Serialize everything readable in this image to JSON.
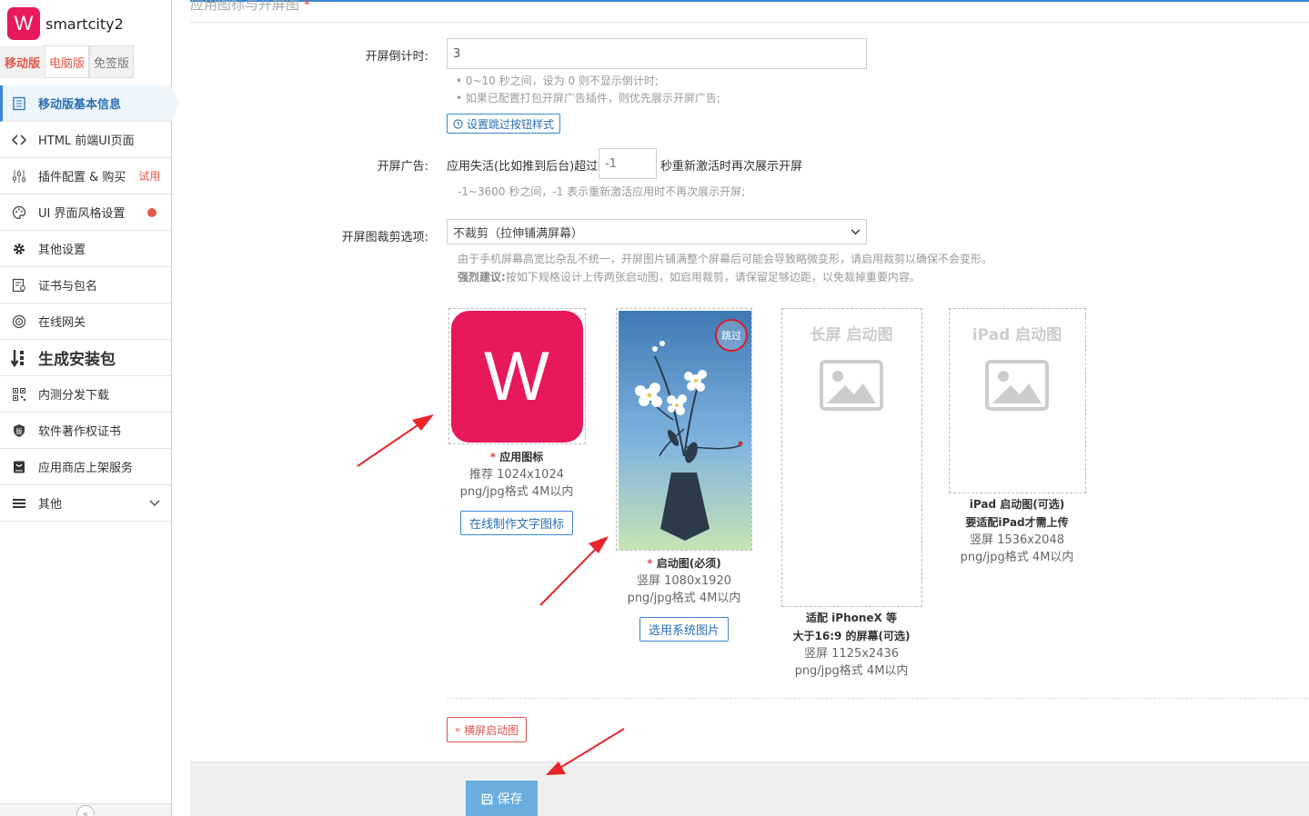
{
  "app": {
    "logo_letter": "W",
    "name": "smartcity2"
  },
  "modes": [
    "移动版",
    "电脑版",
    "免签版"
  ],
  "nav": [
    {
      "label": "移动版基本信息",
      "icon": "document-icon"
    },
    {
      "label": "HTML 前端UI页面",
      "icon": "code-icon"
    },
    {
      "label": "插件配置 & 购买",
      "icon": "sliders-icon",
      "badge": "试用"
    },
    {
      "label": "UI 界面风格设置",
      "icon": "palette-icon"
    },
    {
      "label": "其他设置",
      "icon": "gear-icon"
    },
    {
      "label": "证书与包名",
      "icon": "certificate-icon"
    },
    {
      "label": "在线网关",
      "icon": "gateway-icon"
    },
    {
      "label": "生成安装包",
      "icon": "build-icon"
    },
    {
      "label": "内测分发下载",
      "icon": "qrcode-icon"
    },
    {
      "label": "软件著作权证书",
      "icon": "copyright-icon"
    },
    {
      "label": "应用商店上架服务",
      "icon": "store-icon"
    },
    {
      "label": "其他",
      "icon": "menu-icon"
    }
  ],
  "section": {
    "title": "应用图标与开屏图",
    "star": "*"
  },
  "countdown": {
    "label": "开屏倒计时:",
    "value": "3",
    "hint1": "• 0~10 秒之间，设为 0 则不显示倒计时;",
    "hint2": "• 如果已配置打包开屏广告插件，则优先展示开屏广告;",
    "skip_style_btn": "设置跳过按钮样式"
  },
  "ad": {
    "label": "开屏广告:",
    "prefix": "应用失活(比如推到后台)超过",
    "value": "-1",
    "suffix": "秒重新激活时再次展示开屏",
    "hint": "-1~3600 秒之间，-1 表示重新激活应用时不再次展示开屏;"
  },
  "crop": {
    "label": "开屏图裁剪选项:",
    "selected": "不裁剪（拉伸铺满屏幕）",
    "hint1": "由于手机屏幕高宽比杂乱不统一，开屏图片铺满整个屏幕后可能会导致略微变形，请启用裁剪以确保不会变形。",
    "hint2_bold": "强烈建议:",
    "hint2": "按如下规格设计上传两张启动图，如启用裁剪，请保留足够边距，以免裁掉重要内容。"
  },
  "cards": {
    "icon": {
      "letter": "W",
      "title": "应用图标",
      "size": "推荐 1024x1024",
      "format": "png/jpg格式 4M以内",
      "button": "在线制作文字图标"
    },
    "splash": {
      "skip": "跳过",
      "title": "启动图(必须)",
      "size": "竖屏 1080x1920",
      "format": "png/jpg格式 4M以内",
      "button": "选用系统图片"
    },
    "long": {
      "placeholder": "长屏 启动图",
      "title1": "适配 iPhoneX 等",
      "title2": "大于16:9 的屏幕(可选)",
      "size": "竖屏 1125x2436",
      "format": "png/jpg格式 4M以内"
    },
    "ipad": {
      "placeholder": "iPad 启动图",
      "title1": "iPad 启动图(可选)",
      "title2": "要适配iPad才需上传",
      "size": "竖屏 1536x2048",
      "format": "png/jpg格式 4M以内"
    }
  },
  "landscape_btn": "横屏启动图",
  "save_btn": "保存",
  "colors": {
    "brand": "#e8195a",
    "primary": "#3a87d0",
    "danger": "#d9534f",
    "save": "#6aaee0"
  }
}
